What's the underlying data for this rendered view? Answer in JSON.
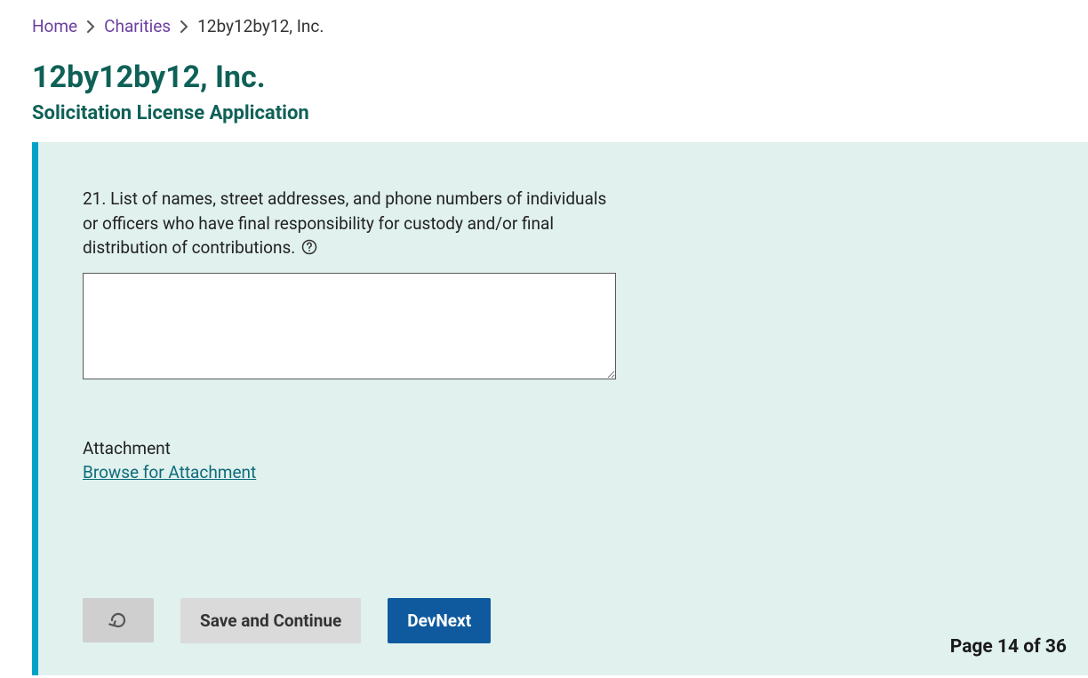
{
  "breadcrumb": {
    "home": "Home",
    "charities": "Charities",
    "current": "12by12by12, Inc."
  },
  "header": {
    "title": "12by12by12, Inc.",
    "subtitle": "Solicitation License Application"
  },
  "form": {
    "question_text": "21. List of names, street addresses, and phone numbers of individuals or officers who have final responsibility for custody and/or final distribution of contributions.",
    "textarea_value": "",
    "attachment_label": "Attachment",
    "browse_link": "Browse for Attachment"
  },
  "buttons": {
    "save_continue": "Save and Continue",
    "dev_next": "DevNext"
  },
  "pagination": {
    "indicator": "Page 14 of 36"
  }
}
